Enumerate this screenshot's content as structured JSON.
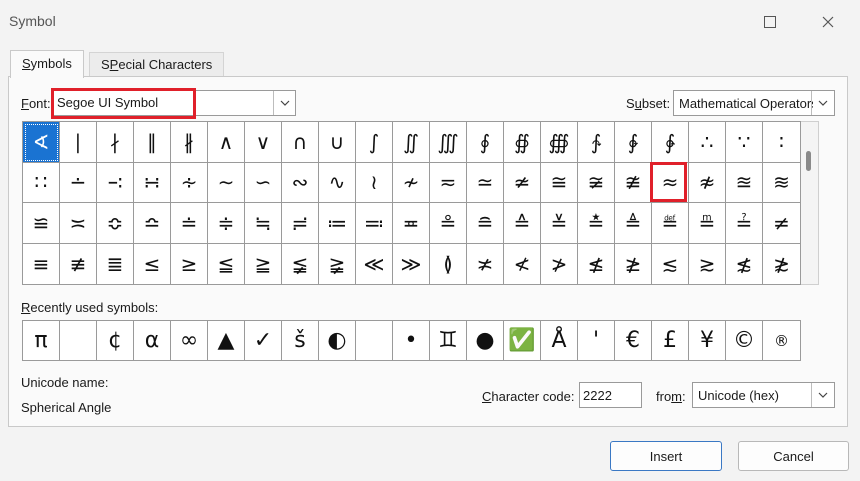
{
  "window": {
    "title": "Symbol"
  },
  "tabs": [
    {
      "label": "Symbols",
      "underline": "S",
      "rest": "ymbols"
    },
    {
      "label": "Special Characters",
      "underline": "P",
      "rest_a": "S",
      "rest_b": "ecial Characters"
    }
  ],
  "font": {
    "label_u": "F",
    "label_rest": "ont:",
    "value": "Segoe UI Symbol"
  },
  "subset": {
    "label_a": "S",
    "label_u": "u",
    "label_rest": "bset:",
    "value": "Mathematical Operators"
  },
  "grid": [
    [
      "∢",
      "∣",
      "∤",
      "∥",
      "∦",
      "∧",
      "∨",
      "∩",
      "∪",
      "∫",
      "∬",
      "∭",
      "∮",
      "∯",
      "∰",
      "∱",
      "∲",
      "∳",
      "∴",
      "∵",
      "∶"
    ],
    [
      "∷",
      "∸",
      "∹",
      "∺",
      "∻",
      "∼",
      "∽",
      "∾",
      "∿",
      "≀",
      "≁",
      "≂",
      "≃",
      "≄",
      "≅",
      "≆",
      "≇",
      "≈",
      "≉",
      "≊",
      "≋"
    ],
    [
      "≌",
      "≍",
      "≎",
      "≏",
      "≐",
      "≑",
      "≒",
      "≓",
      "≔",
      "≕",
      "≖",
      "≗",
      "≘",
      "≙",
      "≚",
      "≛",
      "≜",
      "≝",
      "≞",
      "≟",
      "≠"
    ],
    [
      "≡",
      "≢",
      "≣",
      "≤",
      "≥",
      "≦",
      "≧",
      "≨",
      "≩",
      "≪",
      "≫",
      "≬",
      "≭",
      "≮",
      "≯",
      "≰",
      "≱",
      "≲",
      "≳",
      "≴",
      "≵"
    ]
  ],
  "recent": {
    "label_u": "R",
    "label_rest": "ecently used symbols:",
    "items": [
      "π",
      "",
      "¢",
      "α",
      "∞",
      "▲",
      "✓",
      "š",
      "◐",
      "",
      "•",
      "♊",
      "●",
      "✅",
      "Å",
      "'",
      "€",
      "£",
      "¥",
      "©",
      "®"
    ]
  },
  "unicode": {
    "label": "Unicode name:",
    "value": "Spherical Angle"
  },
  "charcode": {
    "label_u": "C",
    "label_rest": "haracter code:",
    "value": "2222"
  },
  "from": {
    "label_a": "fro",
    "label_u": "m",
    "label_rest": ":",
    "value": "Unicode (hex)"
  },
  "buttons": {
    "insert": "Insert",
    "cancel": "Cancel"
  },
  "colors": {
    "selection": "#1a73d2",
    "highlight": "#e0202a"
  }
}
